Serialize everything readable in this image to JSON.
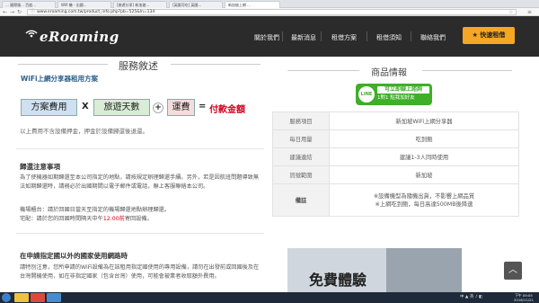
{
  "browser": {
    "tabs": [
      {
        "label": "... 國際服... 百度..."
      },
      {
        "label": "Wifi 機 - 出國..."
      },
      {
        "label": "[旅遊分享] 新加坡..."
      },
      {
        "label": "[英國可吃] 英國..."
      },
      {
        "label": "新加坡上網 ..."
      }
    ],
    "url": "www.eroaming.com.tw/product_info.php?pb=525&ln=134"
  },
  "header": {
    "logo": "eRoaming",
    "nav": [
      "關於我們",
      "最新消息",
      "租借方案",
      "租借須知",
      "聯絡我們"
    ],
    "cta": "快速租借"
  },
  "left": {
    "section_title": "服務敘述",
    "subhead": "WiFi上網分享器租用方案",
    "formula": {
      "box1": "方案費用",
      "op1": "X",
      "box2": "旅遊天數",
      "op2": "+",
      "box3": "運費",
      "op3": "=",
      "result": "付款金額"
    },
    "note": "以上費用不含設備押金，押金於設備歸還後退還。",
    "return_title": "歸還注意事項",
    "return_text1": "為了使機器如期歸還至本公司指定的地點，請按規定辦理歸還手續。另外，若是因航班問題導致無法如期歸還時，請務必於出國期間以電子郵件或電話，聯上客服聯絡本公司。",
    "return_text2a": "機場櫃台：請於回國日當天至指定的機場歸還地點辦理歸還。",
    "return_text2b": "宅配：請於您的回國時間隔天中午",
    "return_text2c": "12:00前",
    "return_text2d": "寄回設備。",
    "outside_title": "在申請指定國以外的國家使用網路時",
    "outside_text": "請特別注意，您所申請的WiFi設備為在該租用指定國使用的專用設備，請勿在出發前或回國後及在台灣開機使用，如在非指定國家（包含台灣）使用，可能會被業者收取額外費用。"
  },
  "right": {
    "title": "商品情報",
    "line_badge": "LINE",
    "line_t1": "可立即線上諮詢",
    "line_t2": "1對1 點我加好友",
    "rows": [
      {
        "k": "服務項目",
        "v": "新加坡WiFi上網分享器"
      },
      {
        "k": "每日用量",
        "v": "吃到飽"
      },
      {
        "k": "建議連結",
        "v": "建議1-3人同時使用"
      },
      {
        "k": "訊號範圍",
        "v": "新加坡"
      },
      {
        "k": "備註",
        "v1": "※設備機型為隨機出貨，不影響上網品質",
        "v2": "※上網吃到飽，每日高達500MB後降速"
      }
    ],
    "promo": "免費體驗"
  },
  "taskbar": {
    "tray": "中 ▲ 英 ♪ ◧",
    "time": "下午 09:05",
    "date": "2016/11/21"
  }
}
